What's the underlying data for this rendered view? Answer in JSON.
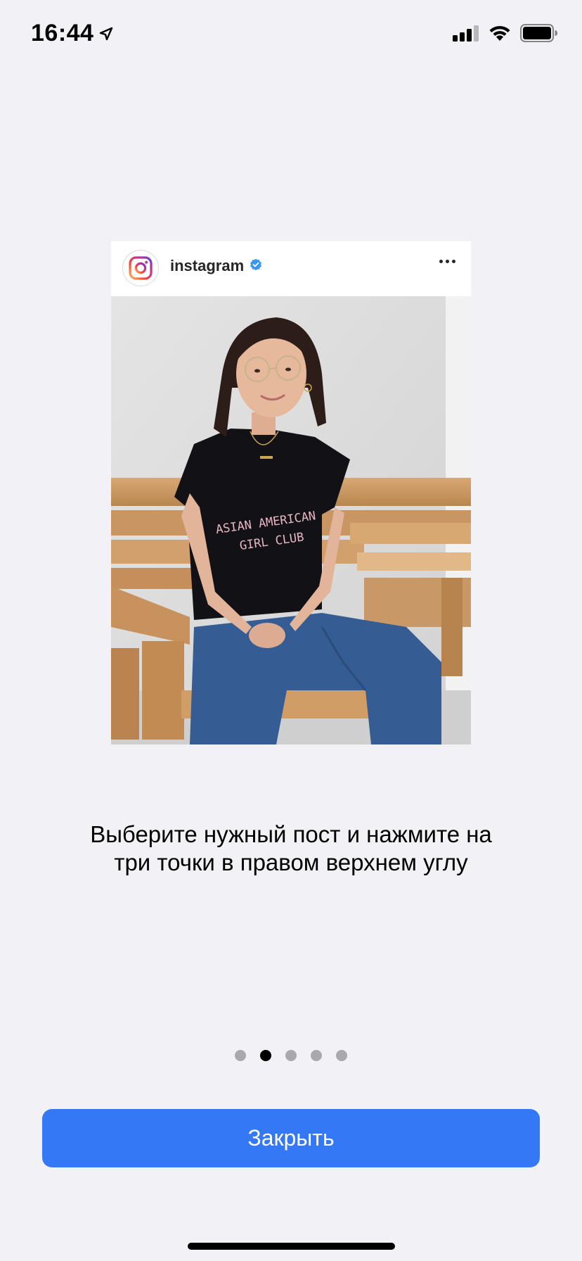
{
  "status_bar": {
    "time": "16:44",
    "icons": [
      "location-arrow-icon",
      "cellular-signal-icon",
      "wifi-icon",
      "battery-icon"
    ]
  },
  "post": {
    "username": "instagram",
    "verified": true,
    "menu_icon": "more-horizontal-icon",
    "avatar_icon": "instagram-logo-icon",
    "shirt_text": "ASIAN AMERICAN GIRL CLUB"
  },
  "instruction": {
    "line1": "Выберите нужный пост и нажмите на",
    "line2": "три точки в правом верхнем углу"
  },
  "pagination": {
    "total": 5,
    "current": 2
  },
  "close_button": {
    "label": "Закрыть"
  },
  "colors": {
    "background": "#f1f1f6",
    "button": "#3478f6",
    "verified": "#3897f0",
    "dot_inactive": "#a9a9ad",
    "dot_active": "#000000"
  }
}
